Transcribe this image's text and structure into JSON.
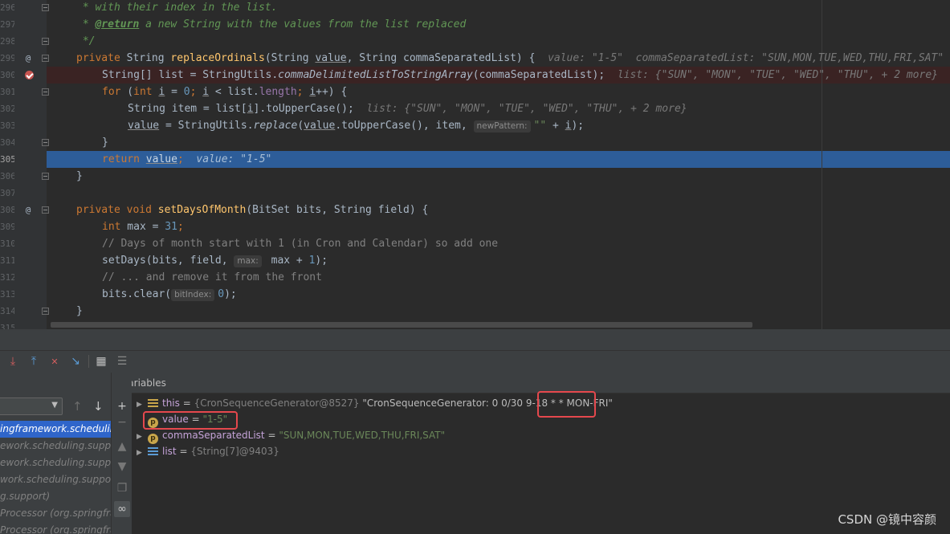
{
  "editor": {
    "line_numbers": [
      "296",
      "297",
      "298",
      "299",
      "300",
      "301",
      "302",
      "303",
      "304",
      "305",
      "306",
      "307",
      "308",
      "309",
      "310",
      "311",
      "312",
      "313",
      "314",
      "315"
    ],
    "code": {
      "l296": " * with their index in the list.",
      "l297_a": " * ",
      "l297_tag": "@return",
      "l297_b": " a new String with the values from the list replaced",
      "l298": " */",
      "l299_kw": "private",
      "l299_type": " String ",
      "l299_fn": "replaceOrdinals",
      "l299_p1": "(String ",
      "l299_p2": "value",
      "l299_p3": ", String commaSeparatedList) {",
      "l299_inline": "value: \"1-5\"  commaSeparatedList: \"SUN,MON,TUE,WED,THU,FRI,SAT\"",
      "l300_a": "String[] list = StringUtils.",
      "l300_fn": "commaDelimitedListToStringArray",
      "l300_b": "(commaSeparatedList);",
      "l300_inline": "list: {\"SUN\", \"MON\", \"TUE\", \"WED\", \"THU\", + 2 more}",
      "l301_kw": "for",
      "l301_a": " (",
      "l301_int": "int",
      "l301_i1": "i",
      "l301_b": " = ",
      "l301_zero": "0",
      "l301_c": "; ",
      "l301_i2": "i",
      "l301_d": " < list.",
      "l301_len": "length",
      "l301_e": "; ",
      "l301_i3": "i",
      "l301_f": "++) {",
      "l302_a": "String item = list[",
      "l302_i": "i",
      "l302_b": "].toUpperCase();",
      "l302_inline": "list: {\"SUN\", \"MON\", \"TUE\", \"WED\", \"THU\", + 2 more}",
      "l303_v1": "value",
      "l303_a": " = StringUtils.",
      "l303_fn": "replace",
      "l303_b": "(",
      "l303_v2": "value",
      "l303_c": ".toUpperCase(), item, ",
      "l303_hint": "newPattern:",
      "l303_str": "\"\"",
      "l303_d": " + ",
      "l303_i": "i",
      "l303_e": ");",
      "l304": "}",
      "l305_kw": "return",
      "l305_v": "value",
      "l305_semi": ";",
      "l305_inline": "value: \"1-5\"",
      "l306": "}",
      "l308_kw": "private",
      "l308_void": " void ",
      "l308_fn": "setDaysOfMonth",
      "l308_rest": "(BitSet bits, String field) {",
      "l309_int": "int",
      "l309_a": " max = ",
      "l309_num": "31",
      "l309_semi": ";",
      "l310": "// Days of month start with 1 (in Cron and Calendar) so add one",
      "l311_a": "setDays(bits, field, ",
      "l311_hint": "max:",
      "l311_b": " max + ",
      "l311_num": "1",
      "l311_c": ");",
      "l312": "// ... and remove it from the front",
      "l313_a": "bits.clear(",
      "l313_hint": "bitIndex:",
      "l313_num": "0",
      "l313_b": ");",
      "l314": "}"
    },
    "gutter_marks": {
      "override": "@",
      "override2": "@"
    }
  },
  "debug": {
    "variables_title": "Variables",
    "frames": [
      "ingframework.scheduling",
      "ework.scheduling.suppo",
      "ework.scheduling.support",
      "work.scheduling.support)",
      "g.support)",
      "Processor (org.springfra",
      "Processor (org.springframe"
    ],
    "variables": [
      {
        "name": "this",
        "eq": " = ",
        "ref": "{CronSequenceGenerator@8527}",
        "value_a": " \"CronSequenceGenerator: 0 0/30 9-18 * ",
        "value_b": "* MON-FRI\""
      },
      {
        "name": "value",
        "eq": " = ",
        "value": "\"1-5\""
      },
      {
        "name": "commaSeparatedList",
        "eq": " = ",
        "value": "\"SUN,MON,TUE,WED,THU,FRI,SAT\""
      },
      {
        "name": "list",
        "eq": " = ",
        "ref": "{String[7]@9403}"
      }
    ],
    "icons": {
      "toolbar": [
        "step-into-icon",
        "force-step-into-icon",
        "step-out-icon",
        "drop-frame-icon",
        "run-to-cursor-icon",
        "evaluate-icon",
        "trace-icon"
      ],
      "side": [
        "add-watch-icon",
        "remove-watch-icon",
        "move-up-icon",
        "move-down-icon",
        "copy-icon",
        "glasses-icon"
      ]
    }
  },
  "watermark": "CSDN @镜中容颜",
  "colors": {
    "editor_bg": "#2b2b2b",
    "execution_line": "#2d5d99",
    "breakpoint": "#c75450",
    "highlight_box": "#e5484d",
    "keyword": "#cc7832",
    "function": "#ffc66d"
  }
}
